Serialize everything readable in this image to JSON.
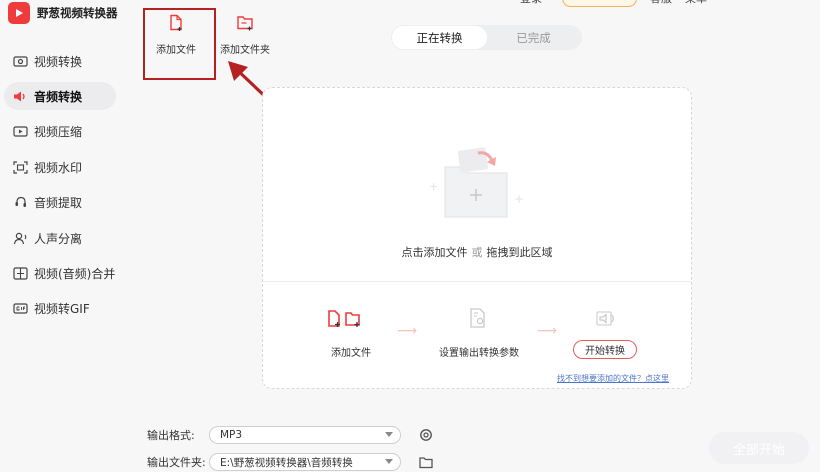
{
  "app": {
    "title": "野葱视频转换器"
  },
  "sidebar": {
    "items": [
      {
        "label": "视频转换",
        "icon": "video-convert-icon"
      },
      {
        "label": "音频转换",
        "icon": "audio-convert-icon",
        "active": true
      },
      {
        "label": "视频压缩",
        "icon": "video-compress-icon"
      },
      {
        "label": "视频水印",
        "icon": "video-watermark-icon"
      },
      {
        "label": "音频提取",
        "icon": "audio-extract-icon"
      },
      {
        "label": "人声分离",
        "icon": "voice-separation-icon"
      },
      {
        "label": "视频(音频)合并",
        "icon": "merge-icon"
      },
      {
        "label": "视频转GIF",
        "icon": "gif-icon"
      }
    ]
  },
  "top_strip": {
    "t1": "登录",
    "t2": "客服",
    "t3": "菜单"
  },
  "toolbar": {
    "add_file": "添加文件",
    "add_folder": "添加文件夹"
  },
  "tabs": {
    "converting": "正在转换",
    "done": "已完成"
  },
  "dropzone": {
    "prompt_part1": "点击添加文件",
    "prompt_or": "或",
    "prompt_part2": "拖拽到此区域"
  },
  "steps": {
    "add_file": "添加文件",
    "set_params": "设置输出转换参数",
    "start_convert": "开始转换",
    "help_link": "找不到想要添加的文件？点这里"
  },
  "output": {
    "format_label": "输出格式:",
    "format_value": "MP3",
    "folder_label": "输出文件夹:",
    "folder_value": "E:\\野葱视频转换器\\音频转换"
  },
  "actions": {
    "start_all": "全部开始"
  },
  "colors": {
    "accent": "#ef3b3b",
    "annotation": "#b52020",
    "link": "#4c74c9"
  }
}
